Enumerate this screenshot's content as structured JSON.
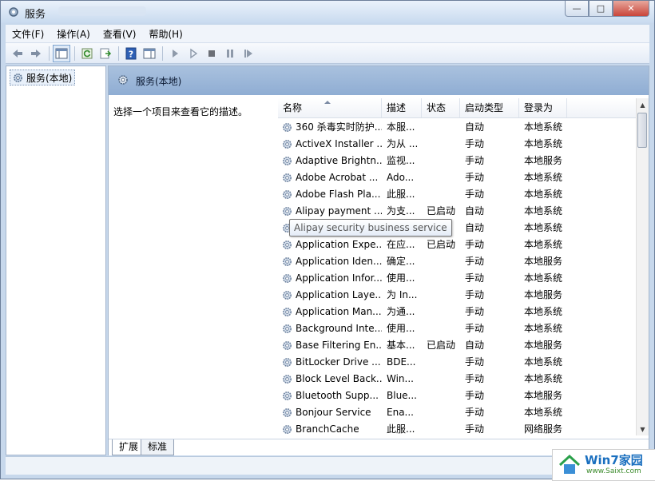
{
  "window": {
    "title": "服务",
    "buttons": {
      "minimize": "—",
      "maximize": "□",
      "close": "✕"
    }
  },
  "menu": [
    "文件(F)",
    "操作(A)",
    "查看(V)",
    "帮助(H)"
  ],
  "toolbar": {
    "icons": [
      "back-arrow-icon",
      "forward-arrow-icon",
      "show-console-tree-icon",
      "refresh-icon",
      "export-list-icon",
      "help-icon",
      "properties-pane-icon",
      "start-service-icon",
      "start-service-alt-icon",
      "stop-service-icon",
      "pause-service-icon",
      "restart-service-icon"
    ]
  },
  "tree": {
    "root_label": "服务(本地)"
  },
  "pane": {
    "header": "服务(本地)",
    "description_prompt": "选择一个项目来查看它的描述。"
  },
  "columns": {
    "name": "名称",
    "description": "描述",
    "status": "状态",
    "startup": "启动类型",
    "logon": "登录为"
  },
  "services": [
    {
      "name": "360 杀毒实时防护...",
      "desc": "本服...",
      "status": "",
      "startup": "自动",
      "logon": "本地系统"
    },
    {
      "name": "ActiveX Installer ...",
      "desc": "为从 ...",
      "status": "",
      "startup": "手动",
      "logon": "本地系统"
    },
    {
      "name": "Adaptive Brightn...",
      "desc": "监视...",
      "status": "",
      "startup": "手动",
      "logon": "本地服务"
    },
    {
      "name": "Adobe Acrobat ...",
      "desc": "Ado...",
      "status": "",
      "startup": "手动",
      "logon": "本地系统"
    },
    {
      "name": "Adobe Flash Pla...",
      "desc": "此服...",
      "status": "",
      "startup": "手动",
      "logon": "本地系统"
    },
    {
      "name": "Alipay payment ...",
      "desc": "为支...",
      "status": "已启动",
      "startup": "自动",
      "logon": "本地系统"
    },
    {
      "name": "Alipay security ...",
      "desc": "",
      "status": "",
      "startup": "自动",
      "logon": "本地系统"
    },
    {
      "name": "Application Expe...",
      "desc": "在应...",
      "status": "已启动",
      "startup": "手动",
      "logon": "本地系统"
    },
    {
      "name": "Application Iden...",
      "desc": "确定...",
      "status": "",
      "startup": "手动",
      "logon": "本地服务"
    },
    {
      "name": "Application Infor...",
      "desc": "使用...",
      "status": "",
      "startup": "手动",
      "logon": "本地系统"
    },
    {
      "name": "Application Laye...",
      "desc": "为 In...",
      "status": "",
      "startup": "手动",
      "logon": "本地服务"
    },
    {
      "name": "Application Man...",
      "desc": "为通...",
      "status": "",
      "startup": "手动",
      "logon": "本地系统"
    },
    {
      "name": "Background Inte...",
      "desc": "使用...",
      "status": "",
      "startup": "手动",
      "logon": "本地系统"
    },
    {
      "name": "Base Filtering En...",
      "desc": "基本...",
      "status": "已启动",
      "startup": "自动",
      "logon": "本地服务"
    },
    {
      "name": "BitLocker Drive ...",
      "desc": "BDE...",
      "status": "",
      "startup": "手动",
      "logon": "本地系统"
    },
    {
      "name": "Block Level Back...",
      "desc": "Win...",
      "status": "",
      "startup": "手动",
      "logon": "本地系统"
    },
    {
      "name": "Bluetooth Supp...",
      "desc": "Blue...",
      "status": "",
      "startup": "手动",
      "logon": "本地服务"
    },
    {
      "name": "Bonjour Service",
      "desc": "Ena...",
      "status": "",
      "startup": "手动",
      "logon": "本地系统"
    },
    {
      "name": "BranchCache",
      "desc": "此服...",
      "status": "",
      "startup": "手动",
      "logon": "网络服务"
    }
  ],
  "tooltip": "Alipay security business service",
  "tabs": [
    "扩展",
    "标准"
  ],
  "watermark": {
    "title": "Win7家园",
    "url": "www.Saixt.com"
  }
}
